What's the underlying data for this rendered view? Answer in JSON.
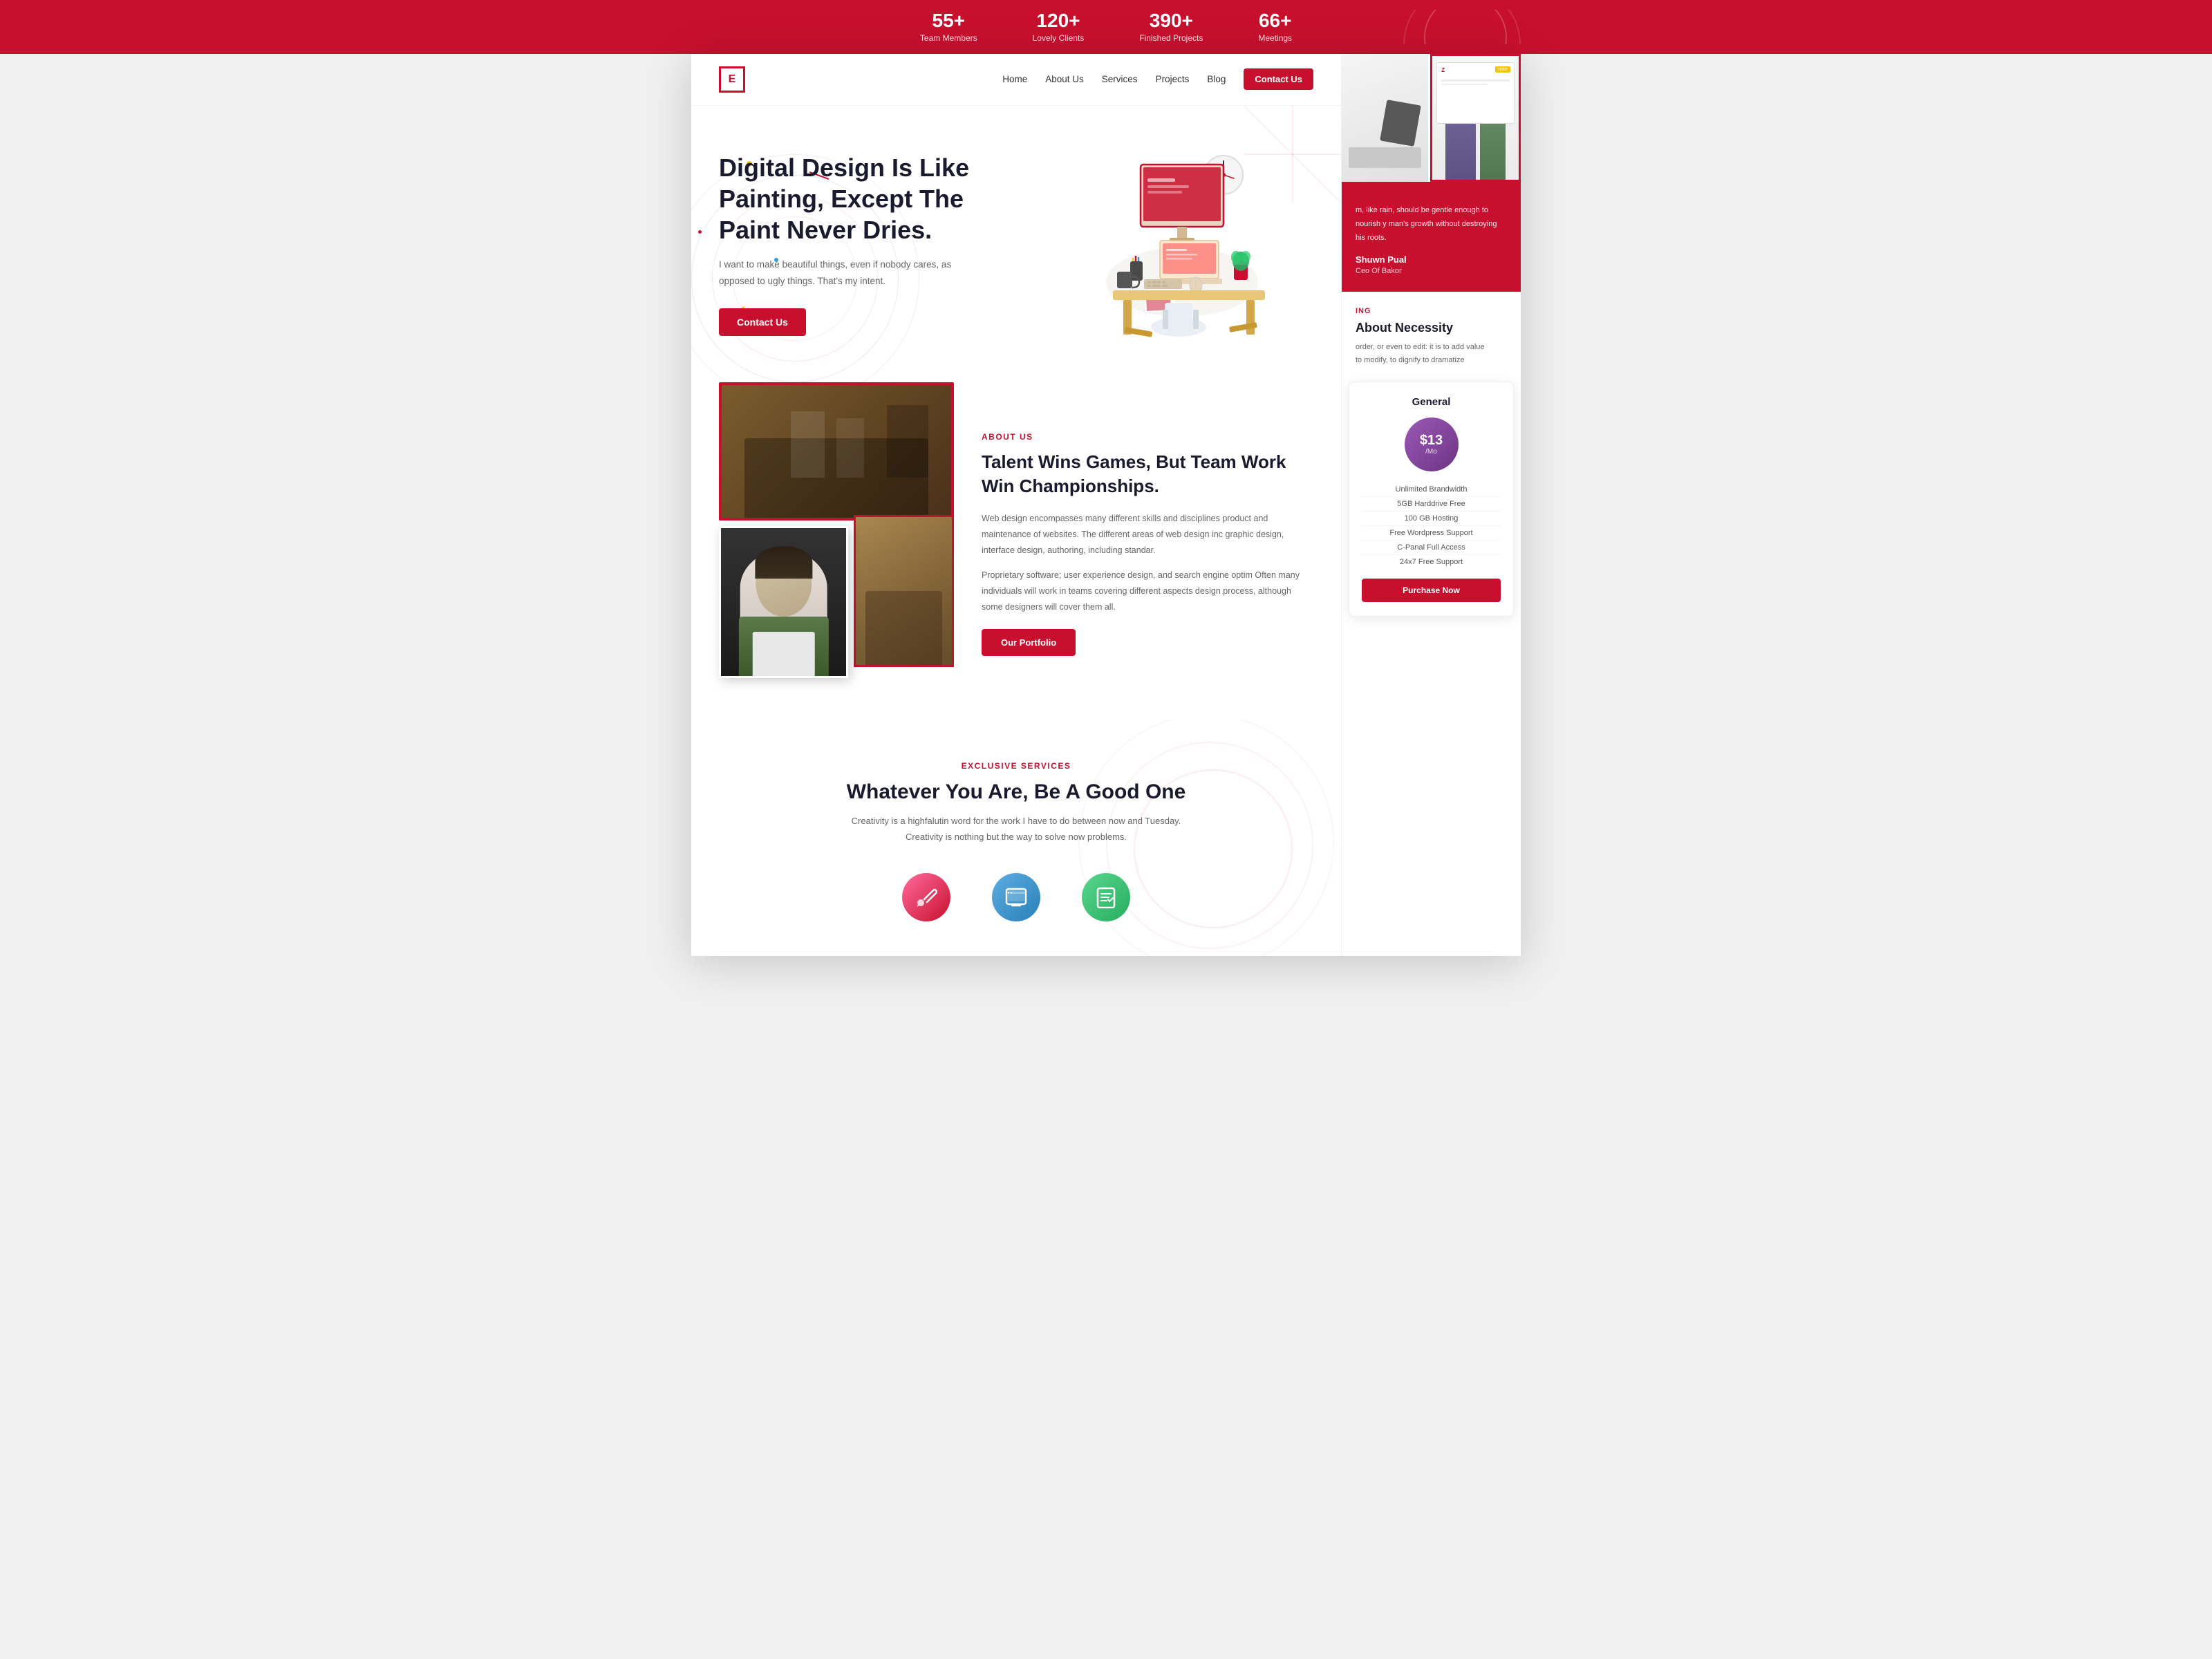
{
  "stats": {
    "items": [
      {
        "number": "55+",
        "label": "Team Members"
      },
      {
        "number": "120+",
        "label": "Lovely Clients"
      },
      {
        "number": "390+",
        "label": "Finished Projects"
      },
      {
        "number": "66+",
        "label": "Meetings"
      }
    ]
  },
  "nav": {
    "logo_text": "E",
    "links": [
      {
        "label": "Home",
        "href": "#"
      },
      {
        "label": "About Us",
        "href": "#"
      },
      {
        "label": "Services",
        "href": "#"
      },
      {
        "label": "Projects",
        "href": "#"
      },
      {
        "label": "Blog",
        "href": "#"
      }
    ],
    "cta_label": "Contact Us"
  },
  "hero": {
    "title": "Digital Design Is Like Painting, Except The Paint Never Dries.",
    "subtitle": "I want to make beautiful things, even if nobody cares, as opposed to ugly things. That's my intent.",
    "cta_label": "Contact Us"
  },
  "about": {
    "tag": "ABOUT US",
    "title": "Talent Wins Games, But Team Work Win Championships.",
    "text1": "Web design encompasses many different skills and disciplines product and maintenance of websites. The different areas of web design inc graphic design, interface design, authoring, including standar.",
    "text2": "Proprietary software; user experience design, and search engine optim Often many individuals will work in teams covering different aspects design process, although some designers will cover them all.",
    "cta_label": "Our Portfolio"
  },
  "services": {
    "tag": "EXCLUSIVE SERVICES",
    "title": "Whatever You Are, Be A Good One",
    "subtitle": "Creativity is a highfalutin word for the work I have to do between now and Tuesday. Creativity is nothing but the way to solve now problems.",
    "icons": [
      {
        "name": "design-icon",
        "color": "#e74c3c",
        "symbol": "✏"
      },
      {
        "name": "web-icon",
        "color": "#3498db",
        "symbol": "🖥"
      },
      {
        "name": "task-icon",
        "color": "#2ecc71",
        "symbol": "✓"
      }
    ]
  },
  "sidebar": {
    "testimonial": {
      "text": "m, like rain, should be gentle enough to nourish y man's growth without destroying his roots.",
      "author": "Shuwn Pual",
      "role": "Ceo Of Bakor"
    },
    "design": {
      "tag": "ING",
      "title": "About Necessity",
      "text1": "order, or even to edit: it is to add value",
      "text2": "to modify, to dignify to dramatize"
    },
    "pricing": {
      "title": "General",
      "price": "$13",
      "period": "/Mo",
      "features": [
        "Unlimited Brandwidth",
        "5GB Harddrive Free",
        "100 GB Hosting",
        "Free Wordpress Support",
        "C-Panal Full Access",
        "24x7 Free Support"
      ],
      "cta_label": "Purchase Now"
    }
  }
}
